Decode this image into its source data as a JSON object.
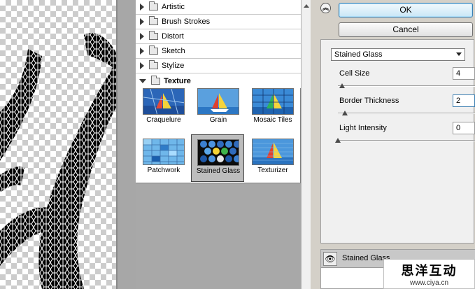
{
  "gallery": {
    "categories": [
      "Artistic",
      "Brush Strokes",
      "Distort",
      "Sketch",
      "Stylize",
      "Texture"
    ],
    "open_category": "Texture",
    "thumbnails": [
      "Craquelure",
      "Grain",
      "Mosaic Tiles",
      "Patchwork",
      "Stained Glass",
      "Texturizer"
    ],
    "selected_thumbnail": "Stained Glass"
  },
  "buttons": {
    "ok": "OK",
    "cancel": "Cancel"
  },
  "settings": {
    "filter_selected": "Stained Glass",
    "params": [
      {
        "label": "Cell Size",
        "value": "4",
        "slider_fraction": 0.03
      },
      {
        "label": "Border Thickness",
        "value": "2",
        "slider_fraction": 0.05
      },
      {
        "label": "Light Intensity",
        "value": "0",
        "slider_fraction": 0.0
      }
    ]
  },
  "layers": {
    "effect_name": "Stained Glass"
  },
  "watermark": {
    "title": "思洋互动",
    "url": "www.ciya.cn"
  },
  "colors": {
    "default_button": "#c9e7f7",
    "panel_bg": "#d4d0c8",
    "selected_thumb": "#bdbdbd"
  }
}
